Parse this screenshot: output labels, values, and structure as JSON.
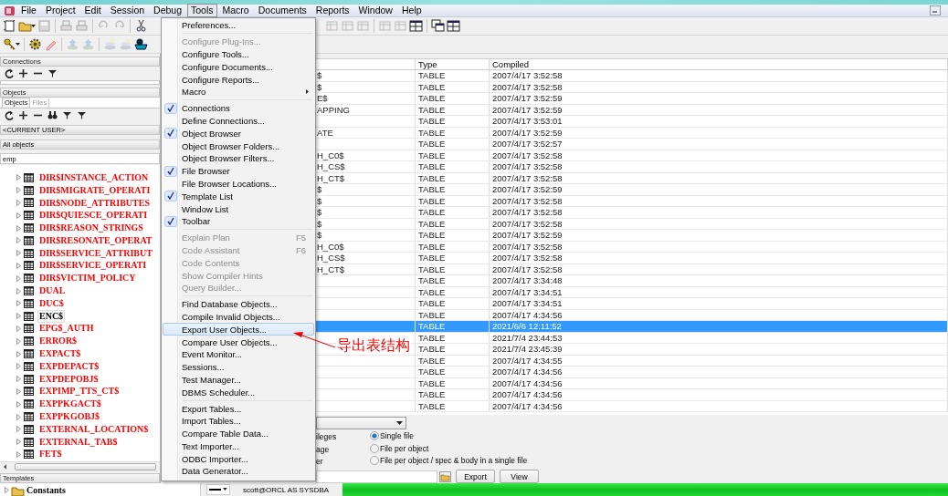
{
  "menu_bar": [
    {
      "label": "File",
      "selected": false
    },
    {
      "label": "Project",
      "selected": false
    },
    {
      "label": "Edit",
      "selected": false
    },
    {
      "label": "Session",
      "selected": false
    },
    {
      "label": "Debug",
      "selected": false
    },
    {
      "label": "Tools",
      "selected": true
    },
    {
      "label": "Macro",
      "selected": false
    },
    {
      "label": "Documents",
      "selected": false
    },
    {
      "label": "Reports",
      "selected": false
    },
    {
      "label": "Window",
      "selected": false
    },
    {
      "label": "Help",
      "selected": false
    }
  ],
  "connections_panel": {
    "title": "Connections"
  },
  "objects_panel": {
    "title": "Objects",
    "tabs": [
      {
        "label": "Objects",
        "selected": true
      },
      {
        "label": "Files",
        "selected": false
      }
    ],
    "user_filter": "<CURRENT USER>",
    "type_filter": "All objects",
    "search": {
      "value": "emp"
    },
    "tree": [
      {
        "label": "DIR$INSTANCE_ACTION",
        "color": "#ff0000",
        "selected": false
      },
      {
        "label": "DIR$MIGRATE_OPERATI",
        "color": "#ff0000",
        "selected": false
      },
      {
        "label": "DIR$NODE_ATTRIBUTES",
        "color": "#ff0000",
        "selected": false
      },
      {
        "label": "DIR$QUIESCE_OPERATI",
        "color": "#ff0000",
        "selected": false
      },
      {
        "label": "DIR$REASON_STRINGS",
        "color": "#ff0000",
        "selected": false
      },
      {
        "label": "DIR$RESONATE_OPERAT",
        "color": "#ff0000",
        "selected": false
      },
      {
        "label": "DIR$SERVICE_ATTRIBUT",
        "color": "#ff0000",
        "selected": false
      },
      {
        "label": "DIR$SERVICE_OPERATI",
        "color": "#ff0000",
        "selected": false
      },
      {
        "label": "DIR$VICTIM_POLICY",
        "color": "#ff0000",
        "selected": false
      },
      {
        "label": "DUAL",
        "color": "#ff0000",
        "selected": false
      },
      {
        "label": "DUC$",
        "color": "#ff0000",
        "selected": false
      },
      {
        "label": "ENC$",
        "color": "#000000",
        "selected": true
      },
      {
        "label": "EPG$_AUTH",
        "color": "#ff0000",
        "selected": false
      },
      {
        "label": "ERROR$",
        "color": "#ff0000",
        "selected": false
      },
      {
        "label": "EXPACT$",
        "color": "#ff0000",
        "selected": false
      },
      {
        "label": "EXPDEPACT$",
        "color": "#ff0000",
        "selected": false
      },
      {
        "label": "EXPDEPOBJ$",
        "color": "#ff0000",
        "selected": false
      },
      {
        "label": "EXPIMP_TTS_CT$",
        "color": "#ff0000",
        "selected": false
      },
      {
        "label": "EXPPKGACT$",
        "color": "#ff0000",
        "selected": false
      },
      {
        "label": "EXPPKGOBJ$",
        "color": "#ff0000",
        "selected": false
      },
      {
        "label": "EXTERNAL_LOCATION$",
        "color": "#ff0000",
        "selected": false
      },
      {
        "label": "EXTERNAL_TAB$",
        "color": "#ff0000",
        "selected": false
      },
      {
        "label": "FET$",
        "color": "#ff0000",
        "selected": false
      }
    ]
  },
  "templates_panel": {
    "title": "Templates",
    "tree": [
      {
        "label": "Constants"
      }
    ]
  },
  "tools_menu": {
    "groups": [
      [
        {
          "label": "Preferences...",
          "checked": false,
          "disabled": false,
          "selected": false
        }
      ],
      [
        {
          "label": "Configure Plug-Ins...",
          "checked": false,
          "disabled": true,
          "selected": false
        },
        {
          "label": "Configure Tools...",
          "checked": false,
          "disabled": false,
          "selected": false
        },
        {
          "label": "Configure Documents...",
          "checked": false,
          "disabled": false,
          "selected": false
        },
        {
          "label": "Configure Reports...",
          "checked": false,
          "disabled": false,
          "selected": false
        },
        {
          "label": "Macro",
          "checked": false,
          "disabled": false,
          "selected": false,
          "submenu": true
        }
      ],
      [
        {
          "label": "Connections",
          "checked": true,
          "disabled": false,
          "selected": false
        },
        {
          "label": "Define Connections...",
          "checked": false,
          "disabled": false,
          "selected": false
        },
        {
          "label": "Object Browser",
          "checked": true,
          "disabled": false,
          "selected": false
        },
        {
          "label": "Object Browser Folders...",
          "checked": false,
          "disabled": false,
          "selected": false
        },
        {
          "label": "Object Browser Filters...",
          "checked": false,
          "disabled": false,
          "selected": false
        },
        {
          "label": "File Browser",
          "checked": true,
          "disabled": false,
          "selected": false
        },
        {
          "label": "File Browser Locations...",
          "checked": false,
          "disabled": false,
          "selected": false
        },
        {
          "label": "Template List",
          "checked": true,
          "disabled": false,
          "selected": false
        },
        {
          "label": "Window List",
          "checked": false,
          "disabled": false,
          "selected": false
        },
        {
          "label": "Toolbar",
          "checked": true,
          "disabled": false,
          "selected": false
        }
      ],
      [
        {
          "label": "Explain Plan",
          "shortcut": "F5",
          "checked": false,
          "disabled": true,
          "selected": false
        },
        {
          "label": "Code Assistant",
          "shortcut": "F6",
          "checked": false,
          "disabled": true,
          "selected": false
        },
        {
          "label": "Code Contents",
          "checked": false,
          "disabled": true,
          "selected": false
        },
        {
          "label": "Show Compiler Hints",
          "checked": false,
          "disabled": true,
          "selected": false
        },
        {
          "label": "Query Builder...",
          "checked": false,
          "disabled": true,
          "selected": false
        }
      ],
      [
        {
          "label": "Find Database Objects...",
          "checked": false,
          "disabled": false,
          "selected": false
        },
        {
          "label": "Compile Invalid Objects...",
          "checked": false,
          "disabled": false,
          "selected": false
        },
        {
          "label": "Export User Objects...",
          "checked": false,
          "disabled": false,
          "selected": true
        },
        {
          "label": "Compare User Objects...",
          "checked": false,
          "disabled": false,
          "selected": false
        },
        {
          "label": "Event Monitor...",
          "checked": false,
          "disabled": false,
          "selected": false
        },
        {
          "label": "Sessions...",
          "checked": false,
          "disabled": false,
          "selected": false
        },
        {
          "label": "Test Manager...",
          "checked": false,
          "disabled": false,
          "selected": false
        },
        {
          "label": "DBMS Scheduler...",
          "checked": false,
          "disabled": false,
          "selected": false
        }
      ],
      [
        {
          "label": "Export Tables...",
          "checked": false,
          "disabled": false,
          "selected": false
        },
        {
          "label": "Import Tables...",
          "checked": false,
          "disabled": false,
          "selected": false
        },
        {
          "label": "Compare Table Data...",
          "checked": false,
          "disabled": false,
          "selected": false
        },
        {
          "label": "Text Importer...",
          "checked": false,
          "disabled": false,
          "selected": false
        },
        {
          "label": "ODBC Importer...",
          "checked": false,
          "disabled": false,
          "selected": false
        },
        {
          "label": "Data Generator...",
          "checked": false,
          "disabled": false,
          "selected": false
        }
      ]
    ]
  },
  "object_table": {
    "columns": [
      "Type",
      "Compiled"
    ],
    "rows": [
      {
        "column_1": "$",
        "type": "TABLE",
        "compiled": "2007/4/17 3:52:58",
        "selected": false
      },
      {
        "column_1": "$",
        "type": "TABLE",
        "compiled": "2007/4/17 3:52:58",
        "selected": false
      },
      {
        "column_1": "E$",
        "type": "TABLE",
        "compiled": "2007/4/17 3:52:59",
        "selected": false
      },
      {
        "column_1": "APPING",
        "type": "TABLE",
        "compiled": "2007/4/17 3:52:59",
        "selected": false
      },
      {
        "type": "TABLE",
        "compiled": "2007/4/17 3:53:01",
        "selected": false
      },
      {
        "column_1": "ATE",
        "type": "TABLE",
        "compiled": "2007/4/17 3:52:59",
        "selected": false
      },
      {
        "type": "TABLE",
        "compiled": "2007/4/17 3:52:57",
        "selected": false
      },
      {
        "column_1": "H_C0$",
        "type": "TABLE",
        "compiled": "2007/4/17 3:52:58",
        "selected": false
      },
      {
        "column_1": "H_CS$",
        "type": "TABLE",
        "compiled": "2007/4/17 3:52:58",
        "selected": false
      },
      {
        "column_1": "H_CT$",
        "type": "TABLE",
        "compiled": "2007/4/17 3:52:58",
        "selected": false
      },
      {
        "column_1": "$",
        "type": "TABLE",
        "compiled": "2007/4/17 3:52:59",
        "selected": false
      },
      {
        "column_1": "$",
        "type": "TABLE",
        "compiled": "2007/4/17 3:52:58",
        "selected": false
      },
      {
        "column_1": "$",
        "type": "TABLE",
        "compiled": "2007/4/17 3:52:58",
        "selected": false
      },
      {
        "column_1": "$",
        "type": "TABLE",
        "compiled": "2007/4/17 3:52:58",
        "selected": false
      },
      {
        "column_1": "$",
        "type": "TABLE",
        "compiled": "2007/4/17 3:52:59",
        "selected": false
      },
      {
        "column_1": "H_C0$",
        "type": "TABLE",
        "compiled": "2007/4/17 3:52:58",
        "selected": false
      },
      {
        "column_1": "H_CS$",
        "type": "TABLE",
        "compiled": "2007/4/17 3:52:58",
        "selected": false
      },
      {
        "column_1": "H_CT$",
        "type": "TABLE",
        "compiled": "2007/4/17 3:52:58",
        "selected": false
      },
      {
        "type": "TABLE",
        "compiled": "2007/4/17 3:34:48",
        "selected": false
      },
      {
        "type": "TABLE",
        "compiled": "2007/4/17 3:34:51",
        "selected": false
      },
      {
        "type": "TABLE",
        "compiled": "2007/4/17 3:34:51",
        "selected": false
      },
      {
        "type": "TABLE",
        "compiled": "2007/4/17 4:34:56",
        "selected": false
      },
      {
        "type": "TABLE",
        "compiled": "2021/6/6 12:11:52",
        "selected": true
      },
      {
        "type": "TABLE",
        "compiled": "2021/7/4 23:44:53",
        "selected": false
      },
      {
        "type": "TABLE",
        "compiled": "2021/7/4 23:45:39",
        "selected": false
      },
      {
        "type": "TABLE",
        "compiled": "2007/4/17 4:34:55",
        "selected": false
      },
      {
        "type": "TABLE",
        "compiled": "2007/4/17 4:34:56",
        "selected": false
      },
      {
        "type": "TABLE",
        "compiled": "2007/4/17 4:34:56",
        "selected": false
      },
      {
        "type": "TABLE",
        "compiled": "2007/4/17 4:34:56",
        "selected": false
      },
      {
        "type": "TABLE",
        "compiled": "2007/4/17 4:34:56",
        "selected": false
      }
    ]
  },
  "export_panel": {
    "option_labels": [
      "ileges",
      "age",
      "er"
    ],
    "output_modes": [
      {
        "label": "Single file",
        "selected": true
      },
      {
        "label": "File per object",
        "selected": false
      },
      {
        "label": "File per object / spec & body in a single file",
        "selected": false
      }
    ],
    "buttons": [
      "Export",
      "View"
    ]
  },
  "status_bar": {
    "connection": "scott@ORCL AS SYSDBA"
  },
  "annotation": {
    "text": "导出表结构"
  }
}
